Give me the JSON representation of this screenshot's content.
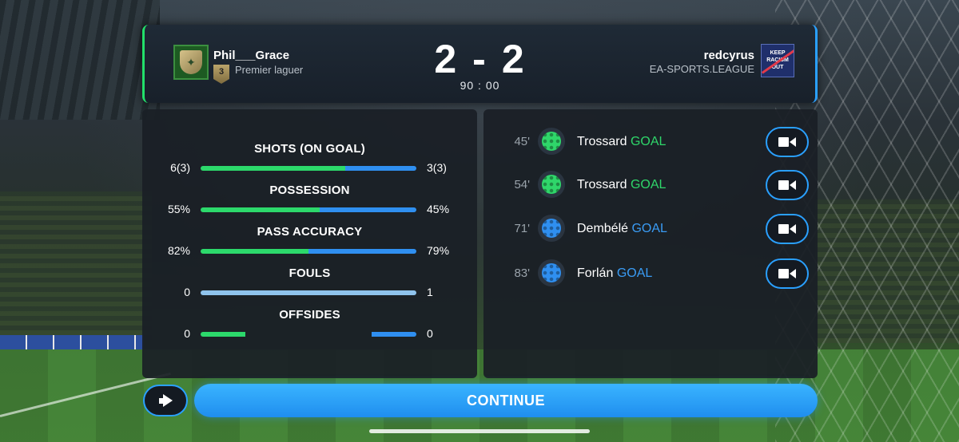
{
  "header": {
    "home": {
      "name": "Phil___Grace",
      "rank": "3",
      "division": "Premier laguer"
    },
    "away": {
      "name": "redcyrus",
      "division": "EA-SPORTS.LEAGUE",
      "crest_text": "KEEP RACISM OUT"
    },
    "score": {
      "home": "2",
      "separator": "-",
      "away": "2"
    },
    "clock": "90 : 00"
  },
  "stats": [
    {
      "label": "SHOTS (ON GOAL)",
      "home": "6(3)",
      "away": "3(3)",
      "home_share": 0.67
    },
    {
      "label": "POSSESSION",
      "home": "55%",
      "away": "45%",
      "home_share": 0.55
    },
    {
      "label": "PASS ACCURACY",
      "home": "82%",
      "away": "79%",
      "home_share": 0.5
    },
    {
      "label": "FOULS",
      "home": "0",
      "away": "1",
      "home_share": 0
    },
    {
      "label": "OFFSIDES",
      "home": "0",
      "away": "0",
      "home_share": 0.5
    }
  ],
  "events": [
    {
      "minute": "45'",
      "player": "Trossard",
      "type": "GOAL",
      "team": "home"
    },
    {
      "minute": "54'",
      "player": "Trossard",
      "type": "GOAL",
      "team": "home"
    },
    {
      "minute": "71'",
      "player": "Dembélé",
      "type": "GOAL",
      "team": "away"
    },
    {
      "minute": "83'",
      "player": "Forlán",
      "type": "GOAL",
      "team": "away"
    }
  ],
  "buttons": {
    "continue": "CONTINUE"
  },
  "icons": {
    "video": "video-camera-icon",
    "megaphone": "megaphone-icon",
    "goal": "football-icon"
  },
  "colors": {
    "home": "#2cd96b",
    "away": "#2f8ff0",
    "accent": "#2aa0ff"
  }
}
